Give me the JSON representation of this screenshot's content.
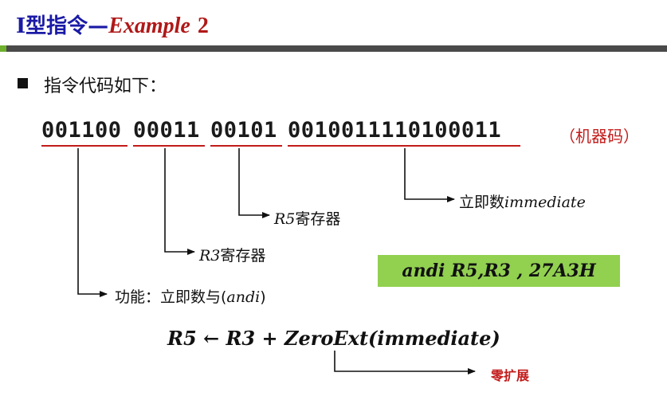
{
  "slide": {
    "title_cn": "I型指令—",
    "title_example": "Example",
    "title_number": "2",
    "intro": "指令代码如下："
  },
  "code": {
    "fields": [
      "001100",
      "00011",
      "00101",
      "0010011110100011"
    ],
    "note": "（机器码）"
  },
  "annotations": {
    "immediate_cn": "立即数",
    "immediate_en": "immediate",
    "r5_reg": "R5",
    "r5_cn": "寄存器",
    "r3_reg": "R3",
    "r3_cn": "寄存器",
    "func_cn": "功能：立即数与(",
    "func_en": "andi",
    "func_close": ")"
  },
  "instruction": "andi  R5,R3 , 27A3H",
  "formula": "R5 ← R3 + ZeroExt(immediate)",
  "zero_ext_note": "零扩展",
  "colors": {
    "title_blue": "#1a1aa6",
    "accent_red": "#c21b1b",
    "highlight_green": "#92d050",
    "header_bar": "#4a4a4a"
  }
}
